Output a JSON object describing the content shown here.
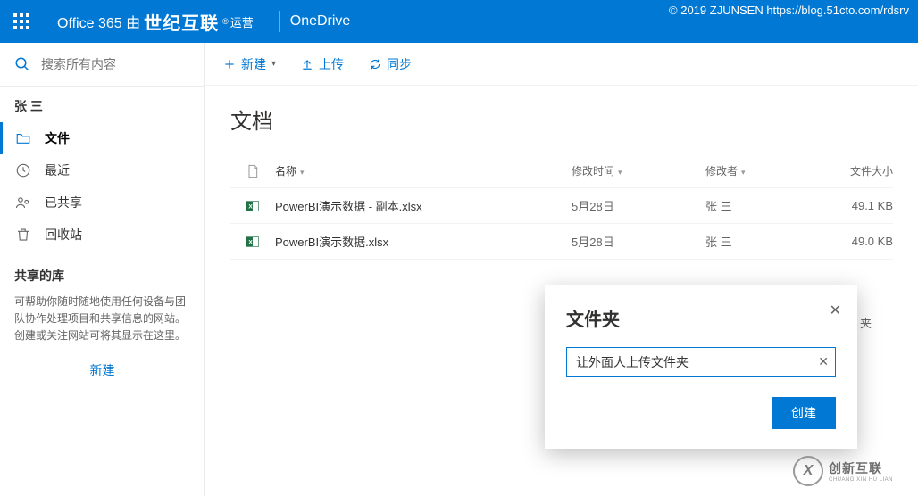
{
  "header": {
    "brand_prefix": "Office 365 由",
    "brand_bold": "世纪互联",
    "brand_suffix": "运营",
    "app": "OneDrive",
    "copyright": "© 2019 ZJUNSEN https://blog.51cto.com/rdsrv"
  },
  "search": {
    "placeholder": "搜索所有内容"
  },
  "user": {
    "name": "张 三"
  },
  "nav": {
    "files": "文件",
    "recent": "最近",
    "shared": "已共享",
    "recycle": "回收站"
  },
  "library": {
    "title": "共享的库",
    "desc": "可帮助你随时随地使用任何设备与团队协作处理项目和共享信息的网站。创建或关注网站可将其显示在这里。",
    "new": "新建"
  },
  "cmd": {
    "new": "新建",
    "upload": "上传",
    "sync": "同步"
  },
  "page": {
    "title": "文档"
  },
  "cols": {
    "name": "名称",
    "modified": "修改时间",
    "modifiedby": "修改者",
    "size": "文件大小"
  },
  "rows": [
    {
      "name": "PowerBI演示数据 - 副本.xlsx",
      "modified": "5月28日",
      "modifiedby": "张 三",
      "size": "49.1 KB"
    },
    {
      "name": "PowerBI演示数据.xlsx",
      "modified": "5月28日",
      "modifiedby": "张 三",
      "size": "49.0 KB"
    }
  ],
  "dialog": {
    "title": "文件夹",
    "value": "让外面人上传文件夹",
    "create": "创建"
  },
  "behind_text": "夹",
  "logo": {
    "big": "创新互联",
    "small": "CHUANG XIN HU LIAN"
  }
}
